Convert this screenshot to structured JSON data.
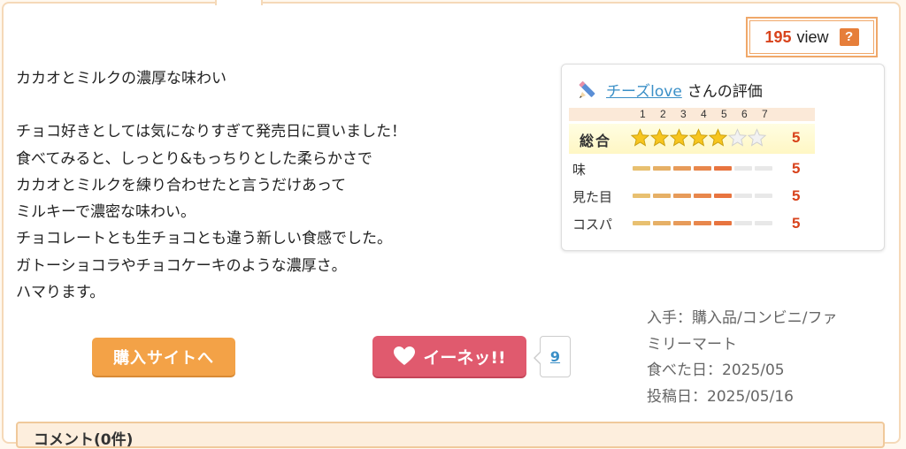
{
  "views": {
    "count": "195",
    "unit": "view",
    "help": "?"
  },
  "review": {
    "title": "カカオとミルクの濃厚な味わい",
    "lines": [
      "チョコ好きとしては気になりすぎて発売日に買いました！",
      "食べてみると、しっとり&もっちりとした柔らかさで",
      "カカオとミルクを練り合わせたと言うだけあって",
      "ミルキーで濃密な味わい。",
      "チョコレートとも生チョコとも違う新しい食感でした。",
      "ガトーショコラやチョコケーキのような濃厚さ。",
      "ハマります。"
    ]
  },
  "rating": {
    "user": "チーズlove",
    "suffix": "さんの評価",
    "scale": [
      "1",
      "2",
      "3",
      "4",
      "5",
      "6",
      "7"
    ],
    "total": {
      "label": "総合",
      "value": 5,
      "max": 7,
      "score": "5"
    },
    "items": [
      {
        "label": "味",
        "value": 5,
        "score": "5"
      },
      {
        "label": "見た目",
        "value": 5,
        "score": "5"
      },
      {
        "label": "コスパ",
        "value": 5,
        "score": "5"
      }
    ],
    "colors": {
      "star": "#f7c51e",
      "bar_fill": [
        "#e8c070",
        "#e6b066",
        "#e79b5a",
        "#e8874c",
        "#e8743f"
      ],
      "bar_empty": "#e8e8e8",
      "score": "#d8431c"
    }
  },
  "actions": {
    "buy": "購入サイトへ",
    "like": "イーネッ!!",
    "like_count": "9"
  },
  "meta": {
    "line1": "入手：購入品/コンビニ/ファ",
    "line2": "ミリーマート",
    "line3": "食べた日：2025/05",
    "line4": "投稿日：2025/05/16"
  },
  "comments": {
    "label": "コメント(0件)"
  }
}
